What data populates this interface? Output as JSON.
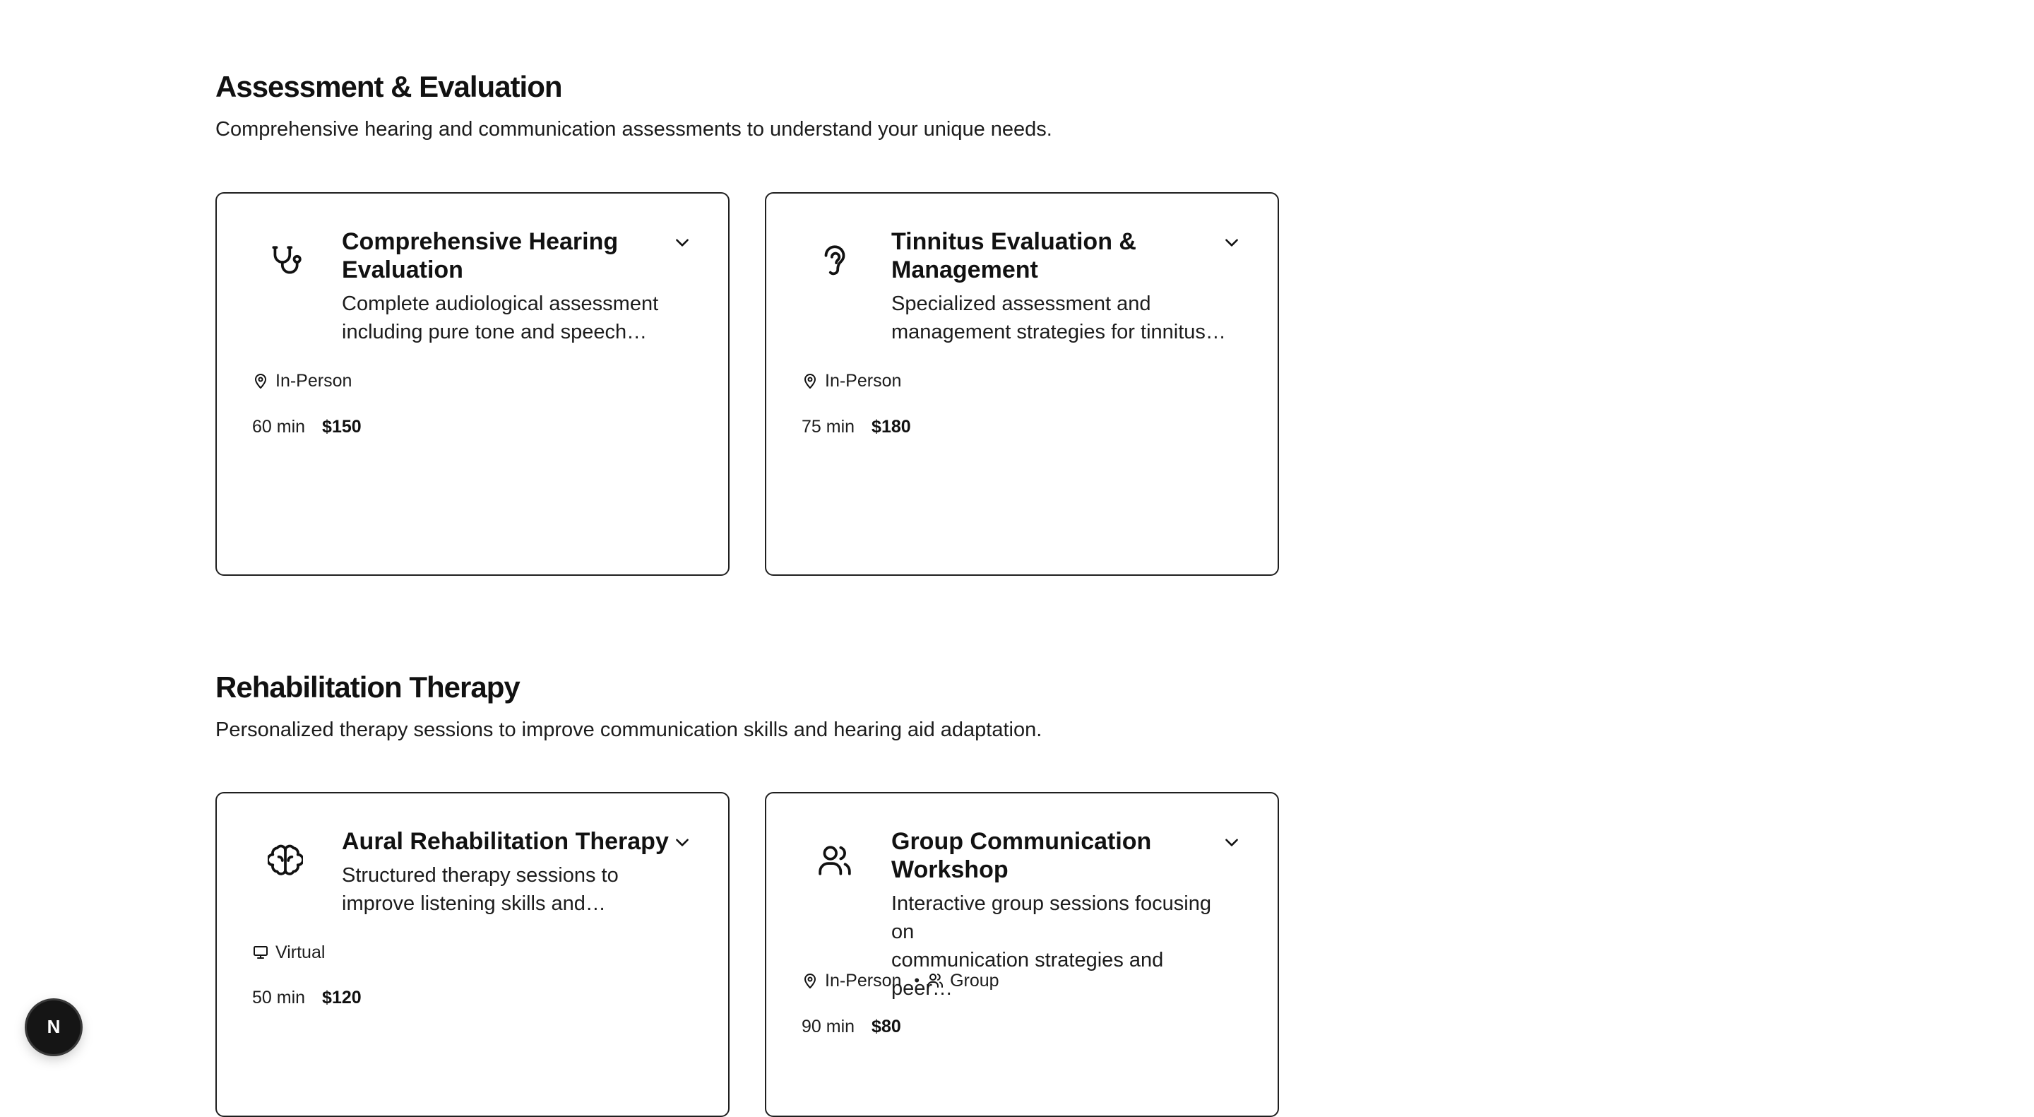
{
  "sections": [
    {
      "title": "Assessment & Evaluation",
      "description": "Comprehensive hearing and communication assessments to understand your unique needs.",
      "cards": [
        {
          "icon": "stethoscope-icon",
          "title": "Comprehensive Hearing Evaluation",
          "description_line1": "Complete audiological assessment",
          "description_line2": "including pure tone and speech…",
          "location": "In-Person",
          "duration": "60 min",
          "price": "$150"
        },
        {
          "icon": "ear-icon",
          "title": "Tinnitus Evaluation & Management",
          "description_line1": "Specialized assessment and",
          "description_line2": "management strategies for tinnitus…",
          "location": "In-Person",
          "duration": "75 min",
          "price": "$180"
        }
      ]
    },
    {
      "title": "Rehabilitation Therapy",
      "description": "Personalized therapy sessions to improve communication skills and hearing aid adaptation.",
      "cards": [
        {
          "icon": "brain-icon",
          "title": "Aural Rehabilitation Therapy",
          "description_line1": "Structured therapy sessions to",
          "description_line2": "improve listening skills and…",
          "location": "Virtual",
          "duration": "50 min",
          "price": "$120"
        },
        {
          "icon": "users-icon",
          "title": "Group Communication Workshop",
          "description_line1": "Interactive group sessions focusing on",
          "description_line2": "communication strategies and peer…",
          "location": "In-Person",
          "format": "Group",
          "duration": "90 min",
          "price": "$80"
        }
      ]
    }
  ],
  "badge": {
    "letter": "N",
    "icon": "nextjs-logo-icon"
  }
}
